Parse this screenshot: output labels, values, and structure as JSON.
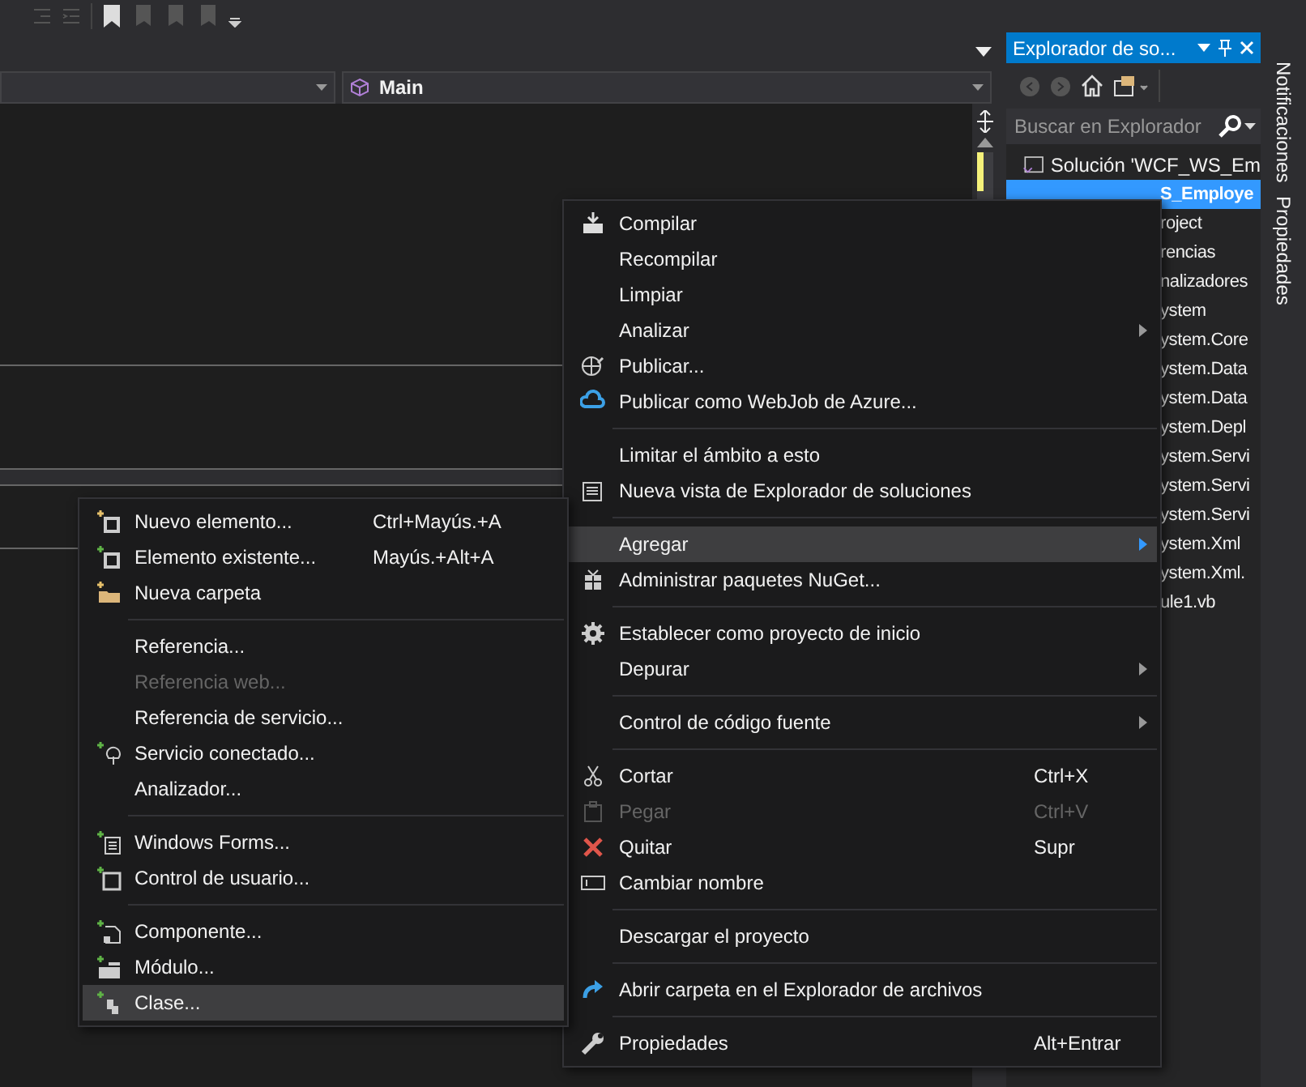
{
  "editor": {
    "member_dropdown": "Main"
  },
  "explorer": {
    "title": "Explorador de so...",
    "search_placeholder": "Buscar en Explorador",
    "tree": [
      {
        "label": "Solución 'WCF_WS_Em",
        "selected": false,
        "children": [
          {
            "label": "S_Employe",
            "selected": true,
            "children": [
              {
                "label": "roject",
                "selected": false
              },
              {
                "label": "rencias",
                "selected": false,
                "children": [
                  {
                    "label": "nalizadores",
                    "selected": false
                  },
                  {
                    "label": "ystem",
                    "selected": false
                  },
                  {
                    "label": "ystem.Core",
                    "selected": false
                  },
                  {
                    "label": "ystem.Data",
                    "selected": false
                  },
                  {
                    "label": "ystem.Data",
                    "selected": false
                  },
                  {
                    "label": "ystem.Depl",
                    "selected": false
                  },
                  {
                    "label": "ystem.Servi",
                    "selected": false
                  },
                  {
                    "label": "ystem.Servi",
                    "selected": false
                  },
                  {
                    "label": "ystem.Servi",
                    "selected": false
                  },
                  {
                    "label": "ystem.Xml",
                    "selected": false
                  },
                  {
                    "label": "ystem.Xml.",
                    "selected": false
                  }
                ]
              },
              {
                "label": "ule1.vb",
                "selected": false
              }
            ]
          }
        ]
      }
    ]
  },
  "side_tabs": [
    "Notificaciones",
    "Propiedades"
  ],
  "context_menu": [
    {
      "kind": "item",
      "label": "Compilar",
      "selected": false,
      "disabled": false
    },
    {
      "kind": "item",
      "label": "Recompilar",
      "selected": false,
      "disabled": false
    },
    {
      "kind": "item",
      "label": "Limpiar",
      "selected": false,
      "disabled": false
    },
    {
      "kind": "item",
      "label": "Analizar",
      "selected": false,
      "disabled": false,
      "submenu": true
    },
    {
      "kind": "item",
      "label": "Publicar...",
      "selected": false,
      "disabled": false
    },
    {
      "kind": "item",
      "label": "Publicar como WebJob de Azure...",
      "selected": false,
      "disabled": false
    },
    {
      "kind": "separator"
    },
    {
      "kind": "item",
      "label": "Limitar el ámbito a esto",
      "selected": false,
      "disabled": false
    },
    {
      "kind": "item",
      "label": "Nueva vista de Explorador de soluciones",
      "selected": false,
      "disabled": false
    },
    {
      "kind": "separator"
    },
    {
      "kind": "item",
      "label": "Agregar",
      "selected": true,
      "disabled": false,
      "submenu": true
    },
    {
      "kind": "item",
      "label": "Administrar paquetes NuGet...",
      "selected": false,
      "disabled": false
    },
    {
      "kind": "separator"
    },
    {
      "kind": "item",
      "label": "Establecer como proyecto de inicio",
      "selected": false,
      "disabled": false
    },
    {
      "kind": "item",
      "label": "Depurar",
      "selected": false,
      "disabled": false,
      "submenu": true
    },
    {
      "kind": "separator"
    },
    {
      "kind": "item",
      "label": "Control de código fuente",
      "selected": false,
      "disabled": false,
      "submenu": true
    },
    {
      "kind": "separator"
    },
    {
      "kind": "item",
      "label": "Cortar",
      "shortcut": "Ctrl+X",
      "selected": false,
      "disabled": false
    },
    {
      "kind": "item",
      "label": "Pegar",
      "shortcut": "Ctrl+V",
      "selected": false,
      "disabled": true
    },
    {
      "kind": "item",
      "label": "Quitar",
      "shortcut": "Supr",
      "selected": false,
      "disabled": false
    },
    {
      "kind": "item",
      "label": "Cambiar nombre",
      "selected": false,
      "disabled": false
    },
    {
      "kind": "separator"
    },
    {
      "kind": "item",
      "label": "Descargar el proyecto",
      "selected": false,
      "disabled": false
    },
    {
      "kind": "separator"
    },
    {
      "kind": "item",
      "label": "Abrir carpeta en el Explorador de archivos",
      "selected": false,
      "disabled": false
    },
    {
      "kind": "separator"
    },
    {
      "kind": "item",
      "label": "Propiedades",
      "shortcut": "Alt+Entrar",
      "selected": false,
      "disabled": false
    }
  ],
  "submenu": [
    {
      "kind": "item",
      "label": "Nuevo elemento...",
      "shortcut": "Ctrl+Mayús.+A",
      "selected": false,
      "disabled": false
    },
    {
      "kind": "item",
      "label": "Elemento existente...",
      "shortcut": "Mayús.+Alt+A",
      "selected": false,
      "disabled": false
    },
    {
      "kind": "item",
      "label": "Nueva carpeta",
      "selected": false,
      "disabled": false
    },
    {
      "kind": "separator"
    },
    {
      "kind": "item",
      "label": "Referencia...",
      "selected": false,
      "disabled": false
    },
    {
      "kind": "item",
      "label": "Referencia web...",
      "selected": false,
      "disabled": true
    },
    {
      "kind": "item",
      "label": "Referencia de servicio...",
      "selected": false,
      "disabled": false
    },
    {
      "kind": "item",
      "label": "Servicio conectado...",
      "selected": false,
      "disabled": false
    },
    {
      "kind": "item",
      "label": "Analizador...",
      "selected": false,
      "disabled": false
    },
    {
      "kind": "separator"
    },
    {
      "kind": "item",
      "label": "Windows Forms...",
      "selected": false,
      "disabled": false
    },
    {
      "kind": "item",
      "label": "Control de usuario...",
      "selected": false,
      "disabled": false
    },
    {
      "kind": "separator"
    },
    {
      "kind": "item",
      "label": "Componente...",
      "selected": false,
      "disabled": false
    },
    {
      "kind": "item",
      "label": "Módulo...",
      "selected": false,
      "disabled": false
    },
    {
      "kind": "item",
      "label": "Clase...",
      "selected": true,
      "disabled": false
    }
  ]
}
